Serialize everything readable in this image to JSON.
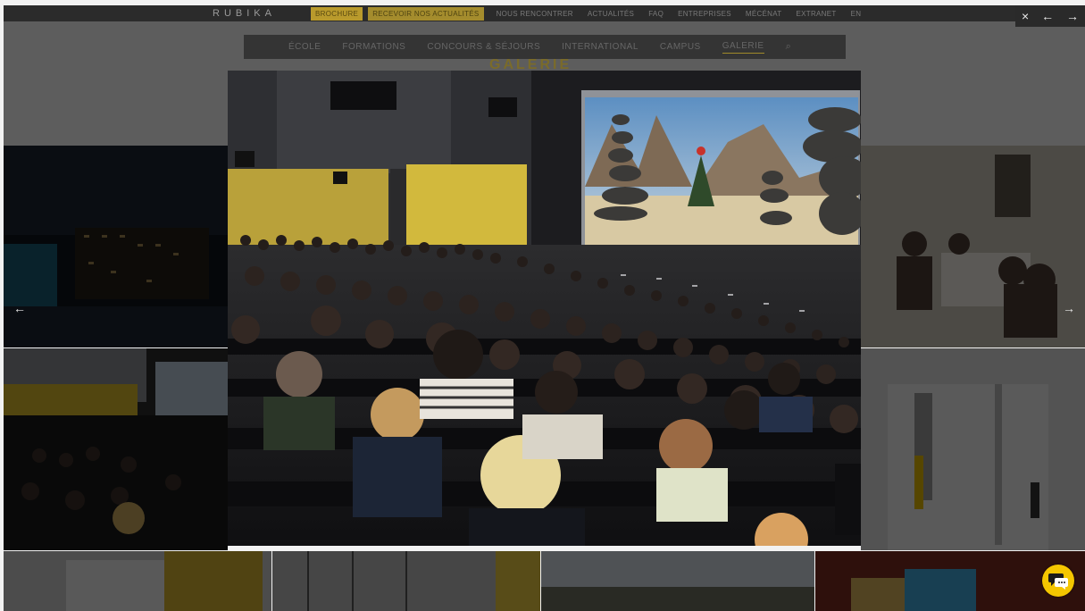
{
  "site": {
    "logo": "RUBIKA",
    "top_buttons": [
      "BROCHURE",
      "RECEVOIR NOS ACTUALITÉS"
    ],
    "top_links": [
      "NOUS RENCONTRER",
      "ACTUALITÉS",
      "FAQ",
      "ENTREPRISES",
      "MÉCÉNAT",
      "EXTRANET",
      "EN"
    ]
  },
  "subnav": {
    "items": [
      "ÉCOLE",
      "FORMATIONS",
      "CONCOURS & SÉJOURS",
      "INTERNATIONAL",
      "CAMPUS",
      "GALERIE"
    ],
    "active": "GALERIE"
  },
  "page_title": "GALERIE",
  "lightbox": {
    "close_icon": "×",
    "prev_icon": "←",
    "next_icon": "→",
    "side_prev_icon": "←",
    "side_next_icon": "→",
    "image_subject": "cinema-audience"
  },
  "chat": {
    "icon": "chat-bubble-icon"
  },
  "colors": {
    "brand_yellow": "#f5c600",
    "overlay": "#000000",
    "topbar": "#2b2b2b"
  }
}
